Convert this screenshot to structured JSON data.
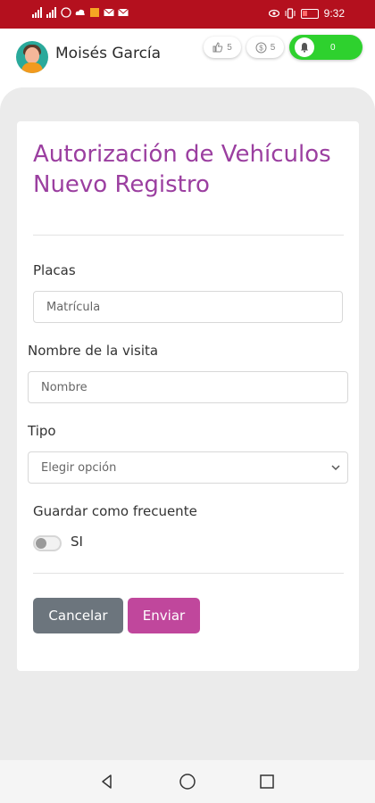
{
  "status_bar": {
    "time": "9:32"
  },
  "header": {
    "user_name": "Moisés García",
    "likes_count": "5",
    "coins_count": "5",
    "notifications_count": "0",
    "notification_color": "#2ed12e"
  },
  "form": {
    "title": "Autorización de Vehículos Nuevo Registro",
    "placas_label": "Placas",
    "placas_placeholder": "Matrícula",
    "visita_label": "Nombre de la visita",
    "visita_placeholder": "Nombre",
    "tipo_label": "Tipo",
    "tipo_selected": "Elegir opción",
    "frecuente_label": "Guardar como frecuente",
    "toggle_label": "SI",
    "toggle_on": false,
    "cancel_label": "Cancelar",
    "send_label": "Enviar"
  },
  "colors": {
    "status_bar": "#b4101e",
    "title": "#9b3fa0",
    "send_button": "#c0479c",
    "cancel_button": "#6c757d"
  }
}
